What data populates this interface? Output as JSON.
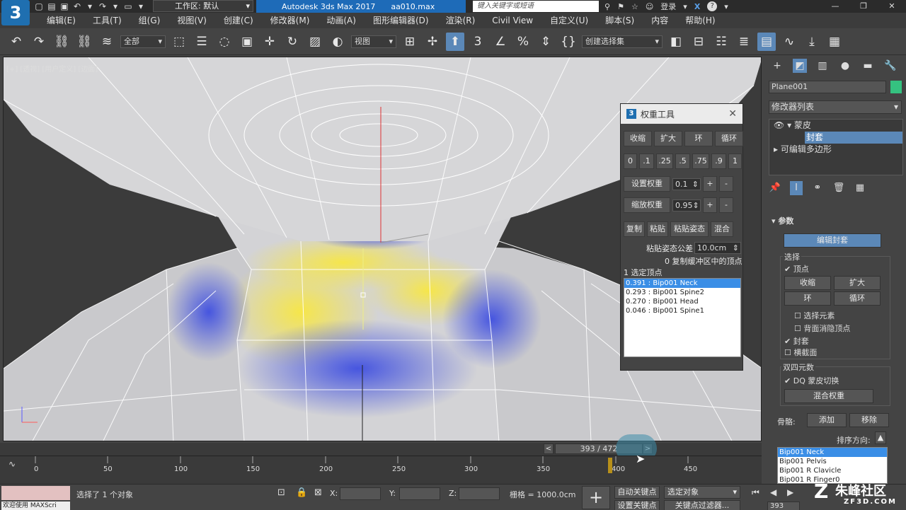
{
  "titlebar": {
    "logo": "3",
    "workspace_label": "工作区: 默认",
    "app_title": "Autodesk 3ds Max 2017",
    "file_name": "aa010.max",
    "search_placeholder": "键入关键字或短语",
    "login_label": "登录"
  },
  "menu": {
    "items": [
      "编辑(E)",
      "工具(T)",
      "组(G)",
      "视图(V)",
      "创建(C)",
      "修改器(M)",
      "动画(A)",
      "图形编辑器(D)",
      "渲染(R)",
      "Civil View",
      "自定义(U)",
      "脚本(S)",
      "内容",
      "帮助(H)"
    ]
  },
  "toolbar": {
    "filter_dropdown": "全部",
    "view_dropdown": "视图",
    "selection_set": "创建选择集"
  },
  "viewport": {
    "label": "[+] [透视] [用户定义] [边面]"
  },
  "weight_tool": {
    "title": "权重工具",
    "logo": "3",
    "row1": [
      "收缩",
      "扩大",
      "环",
      "循环"
    ],
    "presets": [
      "0",
      ".1",
      ".25",
      ".5",
      ".75",
      ".9",
      "1"
    ],
    "set_weight_label": "设置权重",
    "set_weight_value": "0.1",
    "scale_weight_label": "缩放权重",
    "scale_weight_value": "0.95",
    "plus": "+",
    "minus": "-",
    "row_copy": [
      "复制",
      "粘贴",
      "粘贴姿态",
      "混合"
    ],
    "paste_tol_label": "粘贴姿态公差",
    "paste_tol_value": "10.0cm",
    "buffer_info": "0 复制缓冲区中的顶点",
    "selected_info": "1 选定顶点",
    "bones": [
      {
        "label": "0.391 : Bip001 Neck",
        "selected": true
      },
      {
        "label": "0.293 : Bip001 Spine2",
        "selected": false
      },
      {
        "label": "0.270 : Bip001 Head",
        "selected": false
      },
      {
        "label": "0.046 : Bip001 Spine1",
        "selected": false
      }
    ]
  },
  "command_panel": {
    "object_name": "Plane001",
    "object_color": "#35c280",
    "modifier_list": "修改器列表",
    "stack": {
      "skin": "蒙皮",
      "envelope": "封套",
      "editpoly": "可编辑多边形"
    },
    "params_title": "参数",
    "edit_envelope": "编辑封套",
    "select_label": "选择",
    "vertex_label": "顶点",
    "shrink": "收缩",
    "grow": "扩大",
    "ring": "环",
    "loop": "循环",
    "select_element": "选择元素",
    "backface_cull": "背面消隐顶点",
    "envelope_chk": "封套",
    "cross_section": "横截面",
    "dual_quat_label": "双四元数",
    "dq_toggle": "DQ 蒙皮切换",
    "blend_weights": "混合权重",
    "bones_label": "骨骼:",
    "add": "添加",
    "remove": "移除",
    "sort_label": "排序方向:",
    "bone_list": [
      "Bip001 Neck",
      "Bip001 Pelvis",
      "Bip001 R Clavicle",
      "Bip001 R Finger0"
    ]
  },
  "timeline": {
    "frame_display": "393 / 472",
    "ticks": [
      "0",
      "50",
      "100",
      "150",
      "200",
      "250",
      "300",
      "350",
      "400",
      "450"
    ]
  },
  "statusbar": {
    "maxscript_text": "欢迎使用 MAXScri",
    "selection_info": "选择了 1 个对象",
    "x_label": "X:",
    "y_label": "Y:",
    "z_label": "Z:",
    "grid_label": "栅格 = 1000.0cm",
    "auto_key": "自动关键点",
    "set_key": "设置关键点",
    "selected_object": "选定对象",
    "key_filter": "关键点过滤器...",
    "frame_field": "393"
  },
  "watermark": {
    "brand": "朱峰社区",
    "url": "ZF3D.COM"
  }
}
